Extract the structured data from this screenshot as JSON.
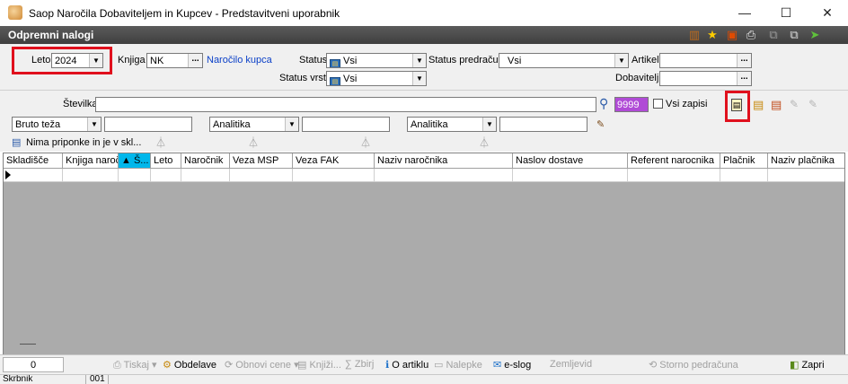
{
  "window": {
    "title": "Saop  Naročila Dobaviteljem in Kupcev - Predstavitveni uporabnik",
    "minimize": "—",
    "maximize": "☐",
    "close": "✕"
  },
  "module": {
    "title": "Odpremni nalogi"
  },
  "filters": {
    "leto_label": "Leto",
    "leto_value": "2024",
    "knjiga_label": "Knjiga",
    "knjiga_value": "NK",
    "knjiga_link": "Naročilo kupca",
    "status_label": "Status",
    "status_value": "Vsi",
    "status_vrstic_label": "Status vrstic",
    "status_vrstic_value": "Vsi",
    "status_predracuna_label": "Status predračuna",
    "status_predracuna_value": "Vsi",
    "artikel_label": "Artikel",
    "dobavitelj_label": "Dobavitelj"
  },
  "search": {
    "stevilka_label": "Številka",
    "limit_value": "9999",
    "vsi_zapisi_label": "Vsi zapisi",
    "bruto_label": "Bruto teža",
    "analitika1_label": "Analitika",
    "analitika2_label": "Analitika",
    "priponke_label": "Nima priponke in je v skl..."
  },
  "grid": {
    "columns": [
      "Skladišče",
      "Knjiga naročila",
      "Š...",
      "Leto",
      "Naročnik",
      "Veza MSP",
      "Veza FAK",
      "Naziv naročnika",
      "Naslov dostave",
      "Referent narocnika",
      "Plačnik",
      "Naziv plačnika"
    ],
    "sort_marker": "▲"
  },
  "bottom": {
    "count": "0",
    "tiskaj": "Tiskaj",
    "obdelave": "Obdelave",
    "obnovi_cene": "Obnovi cene",
    "knjizi": "Knjiži...",
    "zbirj": "Zbirj",
    "o_artiklu": "O artiklu",
    "nalepke": "Nalepke",
    "e_slog": "e-slog",
    "zemljevid": "Zemljevid",
    "storno": "Storno pedračuna",
    "zapri": "Zapri"
  },
  "status": {
    "user": "Skrbnik",
    "code": "001"
  },
  "colors": {
    "highlight_red": "#e0101d",
    "header_dark": "#4a4a4a",
    "sort_cyan": "#00b7eb",
    "limit_purple": "#b04bd6",
    "link_blue": "#0a3fc7"
  }
}
